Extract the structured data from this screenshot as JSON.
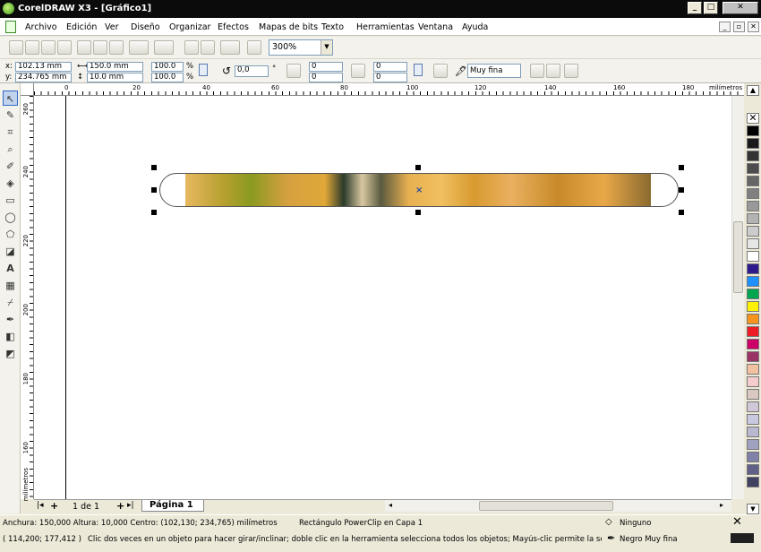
{
  "window": {
    "title": "CorelDRAW X3 - [Gráfico1]",
    "min": "_",
    "max": "□",
    "close": "✕"
  },
  "menu": [
    "Archivo",
    "Edición",
    "Ver",
    "Diseño",
    "Organizar",
    "Efectos",
    "Mapas de bits",
    "Texto",
    "Herramientas",
    "Ventana",
    "Ayuda"
  ],
  "mdi": {
    "min": "_",
    "restore": "▫",
    "close": "✕"
  },
  "toolbar": {
    "zoom_value": "300%"
  },
  "propbar": {
    "x_label": "x:",
    "x_value": "102.13 mm",
    "y_label": "y:",
    "y_value": "234.765 mm",
    "w_value": "150.0 mm",
    "h_value": "10.0 mm",
    "sx_value": "100.0",
    "sy_value": "100.0",
    "pct": "%",
    "angle_value": "0,0",
    "deg": "°",
    "c1": "0",
    "c2": "0",
    "c3": "0",
    "c4": "0",
    "outline_value": "Muy fina"
  },
  "ruler": {
    "unit": "milímetros",
    "h_ticks": [
      "0",
      "20",
      "40",
      "60",
      "80",
      "100",
      "120",
      "140",
      "160",
      "180"
    ],
    "v_ticks": [
      "260",
      "240",
      "220",
      "200",
      "180",
      "160"
    ]
  },
  "pages": {
    "counter": "1 de 1",
    "active_tab": "Página 1"
  },
  "status": {
    "dims": "Anchura: 150,000  Altura: 10,000  Centro: (102,130; 234,765)  milímetros",
    "object": "Rectángulo PowerClip en Capa 1",
    "fill_label": "Ninguno",
    "coords": "( 114,200; 177,412 )",
    "hint": "Clic dos veces en un objeto para hacer girar/inclinar; doble clic en la herramienta selecciona todos los objetos; Mayús-clic permite la selección ...",
    "outline_label": "Negro Muy fina"
  },
  "colors": {
    "palette": [
      "#ffffff",
      "#000000",
      "#1a1a1a",
      "#333333",
      "#4d4d4d",
      "#666666",
      "#808080",
      "#999999",
      "#b3b3b3",
      "#cccccc",
      "#e6e6e6",
      "#ffffff",
      "#2e1a8c",
      "#1e90ff",
      "#00a550",
      "#fff200",
      "#f7941d",
      "#ed1c24",
      "#cc0066",
      "#993366",
      "#f2c2a0",
      "#f4cccc",
      "#d8c8c0",
      "#d0c8d8",
      "#c8c8e0",
      "#b8b8d0",
      "#a0a0c0",
      "#8080a8",
      "#606088",
      "#404060"
    ]
  }
}
